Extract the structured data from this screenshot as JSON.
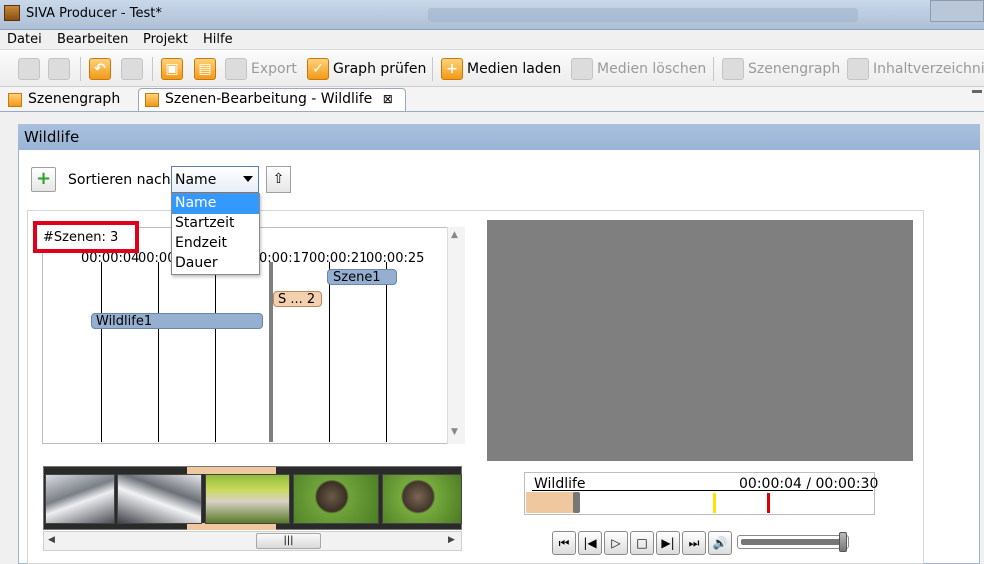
{
  "window": {
    "title": "SIVA Producer - Test*"
  },
  "menubar": {
    "items": [
      "Datei",
      "Bearbeiten",
      "Projekt",
      "Hilfe"
    ]
  },
  "toolbar": {
    "export": "Export",
    "graph_check": "Graph prüfen",
    "load_media": "Medien laden",
    "delete_media": "Medien löschen",
    "scene_graph": "Szenengraph",
    "toc": "Inhaltverzeichnis"
  },
  "tabs": {
    "scene_graph": "Szenengraph",
    "scene_edit": "Szenen-Bearbeitung -   Wildlife",
    "close": "⊠"
  },
  "editor": {
    "title": "Wildlife",
    "sort_label": "Sortieren nach:",
    "sort_value": "Name",
    "sort_options": [
      "Name",
      "Startzeit",
      "Endzeit",
      "Dauer"
    ],
    "scene_count": "#Szenen: 3"
  },
  "timeline": {
    "ticks": [
      "00:00:04",
      "00:00",
      "0:00:17",
      "00:00:21",
      "00:00:25"
    ],
    "scenes": [
      "Wildlife1",
      "S ... 2",
      "Szene1"
    ]
  },
  "player": {
    "name": "Wildlife",
    "time": "00:00:04 / 00:00:30",
    "progress_fraction": 0.14,
    "volume_fraction": 0.93
  },
  "colors": {
    "accent": "#9ab4d6",
    "scene_blue": "#94afd0",
    "scene_orange": "#f3d1b0",
    "highlight_red": "#e0001a"
  }
}
